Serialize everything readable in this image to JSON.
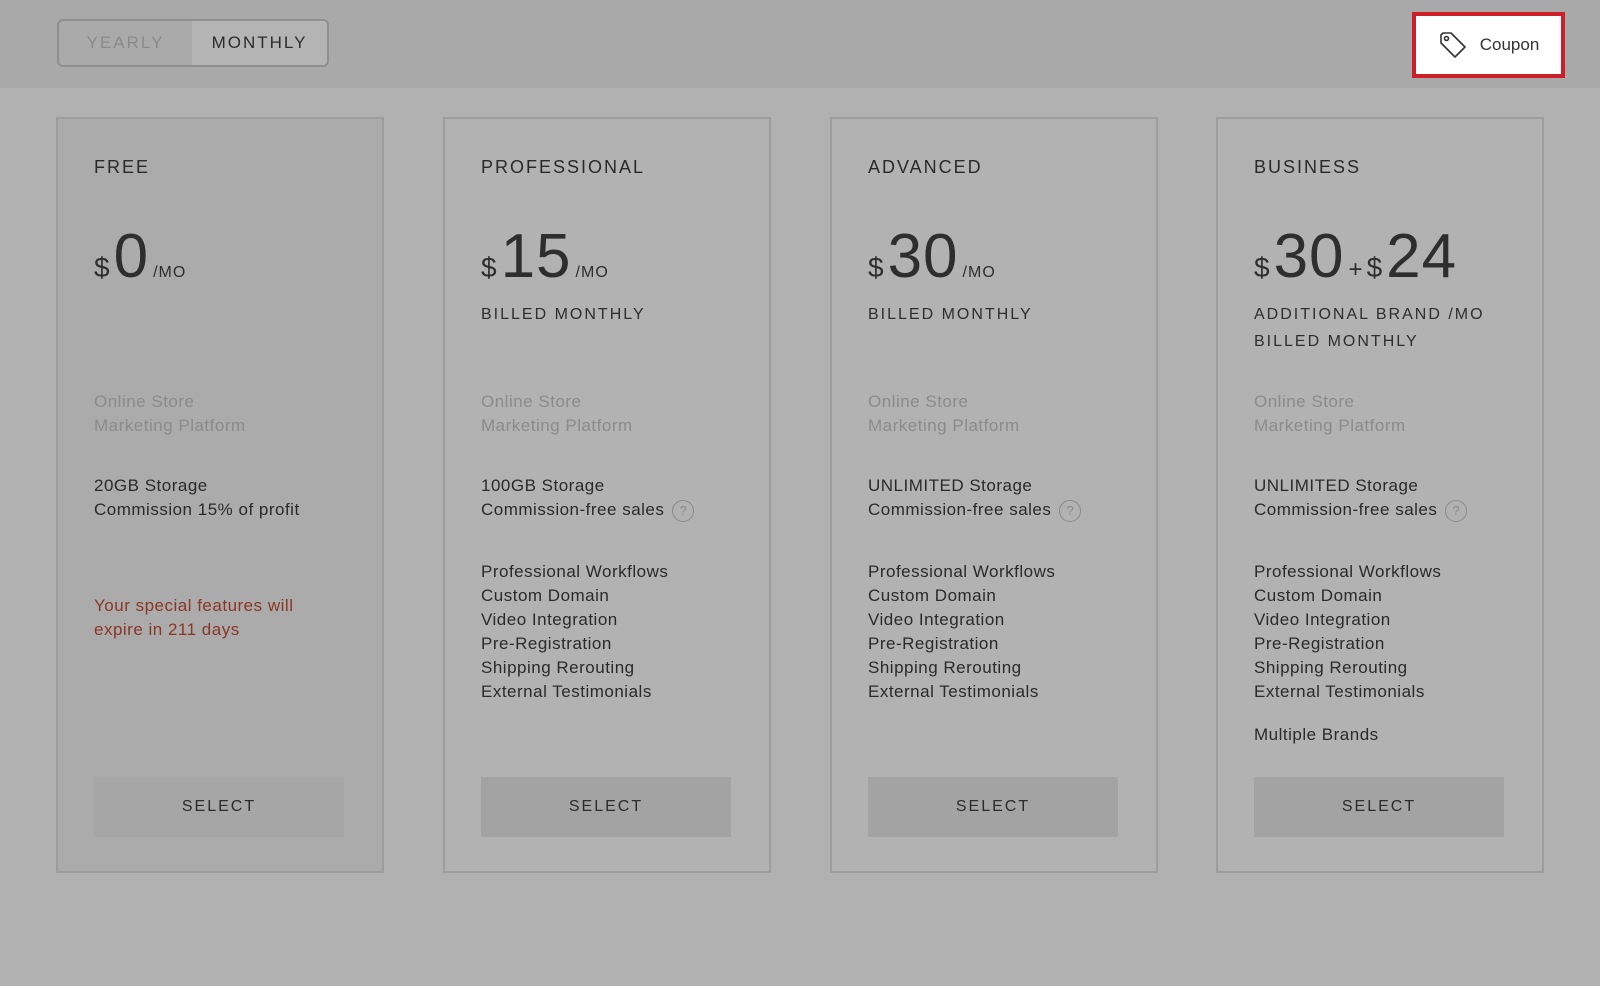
{
  "toggle": {
    "yearly_label": "YEARLY",
    "monthly_label": "MONTHLY",
    "selected": "MONTHLY"
  },
  "coupon": {
    "label": "Coupon",
    "icon": "tag-icon"
  },
  "plans": [
    {
      "name": "FREE",
      "currency": "$",
      "amount": "0",
      "period": "/MO",
      "muted_features": [
        "Online Store",
        "Marketing Platform"
      ],
      "storage": "20GB Storage",
      "commission": "Commission 15% of profit",
      "notice": [
        "Your special features will",
        "expire in 211 days"
      ],
      "select_label": "SELECT"
    },
    {
      "name": "PROFESSIONAL",
      "currency": "$",
      "amount": "15",
      "period": "/MO",
      "billed": "BILLED MONTHLY",
      "muted_features": [
        "Online Store",
        "Marketing Platform"
      ],
      "storage": "100GB Storage",
      "commission": "Commission-free sales",
      "features": [
        "Professional Workflows",
        "Custom Domain",
        "Video Integration",
        "Pre-Registration",
        "Shipping Rerouting",
        "External Testimonials"
      ],
      "select_label": "SELECT"
    },
    {
      "name": "ADVANCED",
      "currency": "$",
      "amount": "30",
      "period": "/MO",
      "billed": "BILLED MONTHLY",
      "muted_features": [
        "Online Store",
        "Marketing Platform"
      ],
      "storage": "UNLIMITED Storage",
      "commission": "Commission-free sales",
      "features": [
        "Professional Workflows",
        "Custom Domain",
        "Video Integration",
        "Pre-Registration",
        "Shipping Rerouting",
        "External Testimonials"
      ],
      "select_label": "SELECT"
    },
    {
      "name": "BUSINESS",
      "currency": "$",
      "amount": "30",
      "plus": "+",
      "currency2": "$",
      "amount2": "24",
      "billed_line1": "ADDITIONAL BRAND /MO",
      "billed_line2": "BILLED MONTHLY",
      "muted_features": [
        "Online Store",
        "Marketing Platform"
      ],
      "storage": "UNLIMITED Storage",
      "commission": "Commission-free sales",
      "features": [
        "Professional Workflows",
        "Custom Domain",
        "Video Integration",
        "Pre-Registration",
        "Shipping Rerouting",
        "External Testimonials"
      ],
      "extra_feature": "Multiple Brands",
      "select_label": "SELECT"
    }
  ],
  "help_glyph": "?",
  "colors": {
    "coupon_border": "#cc1f2a",
    "notice_text": "#8a3626"
  }
}
